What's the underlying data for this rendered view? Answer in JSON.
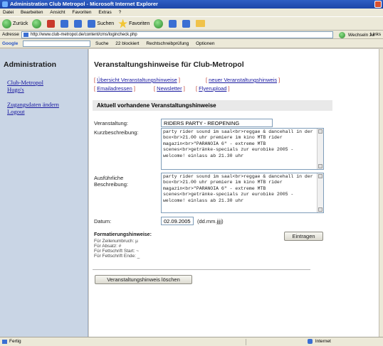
{
  "window": {
    "title": "Administration Club Metropol - Microsoft Internet Explorer"
  },
  "menu": [
    "Datei",
    "Bearbeiten",
    "Ansicht",
    "Favoriten",
    "Extras",
    "?"
  ],
  "toolbar": {
    "back": "Zurück",
    "search": "Suchen",
    "favorites": "Favoriten"
  },
  "address": {
    "label": "Adresse",
    "url": "http://www.club-metropol.de/content/cms/logincheck.php",
    "go": "Wechseln zu",
    "links": "Links"
  },
  "google": {
    "label": "Google",
    "search": "Suche",
    "blocked": "22 blockiert",
    "spell": "Rechtschreibprüfung",
    "options": "Optionen"
  },
  "sidebar": {
    "title": "Administration",
    "links": [
      "Club-Metropol",
      "Hugo's",
      "Zugangsdaten ändern",
      "Logout"
    ]
  },
  "main": {
    "title": "Veranstaltungshinweise für Club-Metropol",
    "nav": [
      "Übersicht Veranstaltungshinweise",
      "neuer Veranstaltungshinweis",
      "Emailadressen",
      "Newsletter",
      "Flyerupload"
    ],
    "section_title": "Aktuell vorhandene Veranstaltungshinweise",
    "fields": {
      "event_label": "Veranstaltung:",
      "event_value": "RIDERS PARTY - REOPENING",
      "short_label": "Kurzbeschreibung:",
      "short_value": "party rider sound im saal<br>reggae & dancehall in der box<br>21.00 uhr premiere im kino MTB rider magazin<br>\"PARANOIA 6\" - extreme MTB scenes<br>getränke-specials zur eurobike 2005 - welcome! einlass ab 21.30 uhr",
      "long_label_1": "Ausführliche",
      "long_label_2": "Beschreibung:",
      "long_value": "party rider sound im saal<br>reggae & dancehall in der box<br>21.00 uhr premiere im kino MTB rider magazin<br>\"PARANOIA 6\" - extreme MTB scenes<br>getränke-specials zur eurobike 2005 - welcome! einlass ab 21.30 uhr",
      "date_label": "Datum:",
      "date_value": "02.09.2005",
      "date_hint": "(dd.mm.jjjj)"
    },
    "hints": {
      "title": "Formatierungshinweise:",
      "items": [
        "Für Zeilenumbruch: µ",
        "Für Absatz: #",
        "Für Fettschrift Start: ~",
        "Für Fettschrift Ende: _"
      ]
    },
    "submit_label": "Eintragen",
    "delete_label": "Veranstaltungshinweis löschen"
  },
  "status": {
    "text": "Fertig",
    "zone": "Internet"
  }
}
